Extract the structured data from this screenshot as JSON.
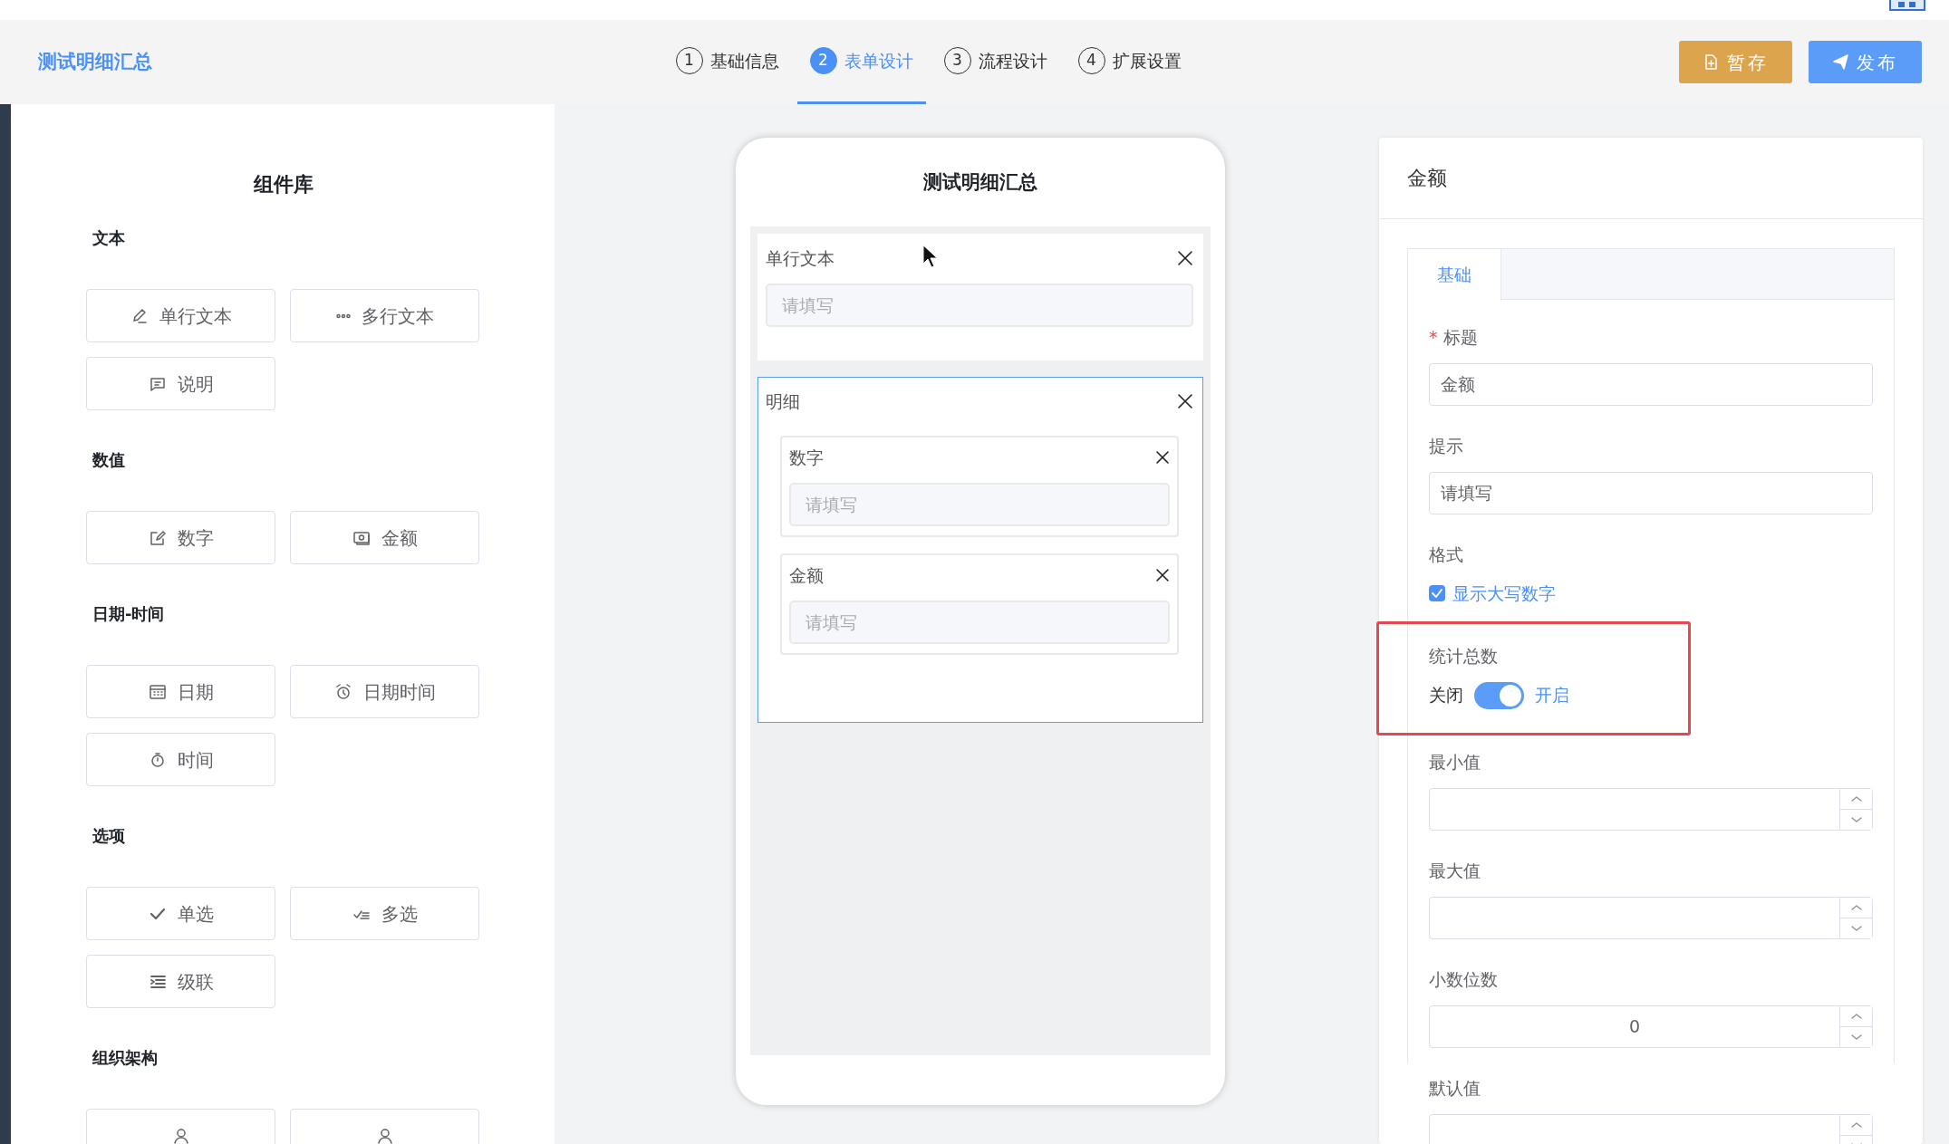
{
  "app_title": "测试明细汇总",
  "steps": [
    {
      "number": "1",
      "label": "基础信息",
      "selected": false
    },
    {
      "number": "2",
      "label": "表单设计",
      "selected": true
    },
    {
      "number": "3",
      "label": "流程设计",
      "selected": false
    },
    {
      "number": "4",
      "label": "扩展设置",
      "selected": false
    }
  ],
  "actions": [
    {
      "kind": "save",
      "label": "暂存"
    },
    {
      "kind": "publish",
      "label": "发布"
    }
  ],
  "library": {
    "title": "组件库",
    "groups": [
      {
        "heading": "文本",
        "items": [
          {
            "kind": "text",
            "label": "单行文本"
          },
          {
            "kind": "textarea",
            "label": "多行文本"
          },
          {
            "kind": "note",
            "label": "说明"
          }
        ]
      },
      {
        "heading": "数值",
        "items": [
          {
            "kind": "number",
            "label": "数字"
          },
          {
            "kind": "money",
            "label": "金额"
          }
        ]
      },
      {
        "heading": "日期-时间",
        "items": [
          {
            "kind": "date",
            "label": "日期"
          },
          {
            "kind": "datetime",
            "label": "日期时间"
          },
          {
            "kind": "time",
            "label": "时间"
          }
        ]
      },
      {
        "heading": "选项",
        "items": [
          {
            "kind": "radio",
            "label": "单选"
          },
          {
            "kind": "checkbox",
            "label": "多选"
          },
          {
            "kind": "cascade",
            "label": "级联"
          }
        ]
      },
      {
        "heading": "组织架构",
        "items": [
          {
            "kind": "user"
          },
          {
            "kind": "users"
          }
        ]
      }
    ]
  },
  "form": {
    "title": "测试明细汇总",
    "fields": [
      {
        "kind": "input",
        "label": "单行文本",
        "placeholder": "请填写",
        "selected": false
      },
      {
        "kind": "table",
        "label": "明细",
        "selected": true,
        "children": [
          {
            "kind": "input",
            "label": "数字",
            "placeholder": "请填写"
          },
          {
            "kind": "input",
            "label": "金额",
            "placeholder": "请填写"
          }
        ]
      }
    ]
  },
  "properties": {
    "title": "金额",
    "required_mark": "*",
    "tabs": [
      {
        "label": "基础",
        "selected": true
      }
    ],
    "fields": [
      {
        "kind": "text",
        "label": "标题",
        "required": true,
        "value": "金额",
        "highlighted": false
      },
      {
        "kind": "text",
        "label": "提示",
        "required": false,
        "value": "请填写",
        "highlighted": false
      },
      {
        "kind": "checkbox",
        "label": "格式",
        "required": false,
        "option": "显示大写数字",
        "checked": true,
        "highlighted": false
      },
      {
        "kind": "switch",
        "label": "统计总数",
        "required": false,
        "off_label": "关闭",
        "on_label": "开启",
        "on": true,
        "highlighted": true
      },
      {
        "kind": "number",
        "label": "最小值",
        "required": false,
        "highlighted": false
      },
      {
        "kind": "number",
        "label": "最大值",
        "required": false,
        "highlighted": false
      },
      {
        "kind": "number",
        "label": "小数位数",
        "required": false,
        "value": "0",
        "highlighted": false
      },
      {
        "kind": "number",
        "label": "默认值",
        "required": false,
        "highlighted": false
      }
    ]
  }
}
